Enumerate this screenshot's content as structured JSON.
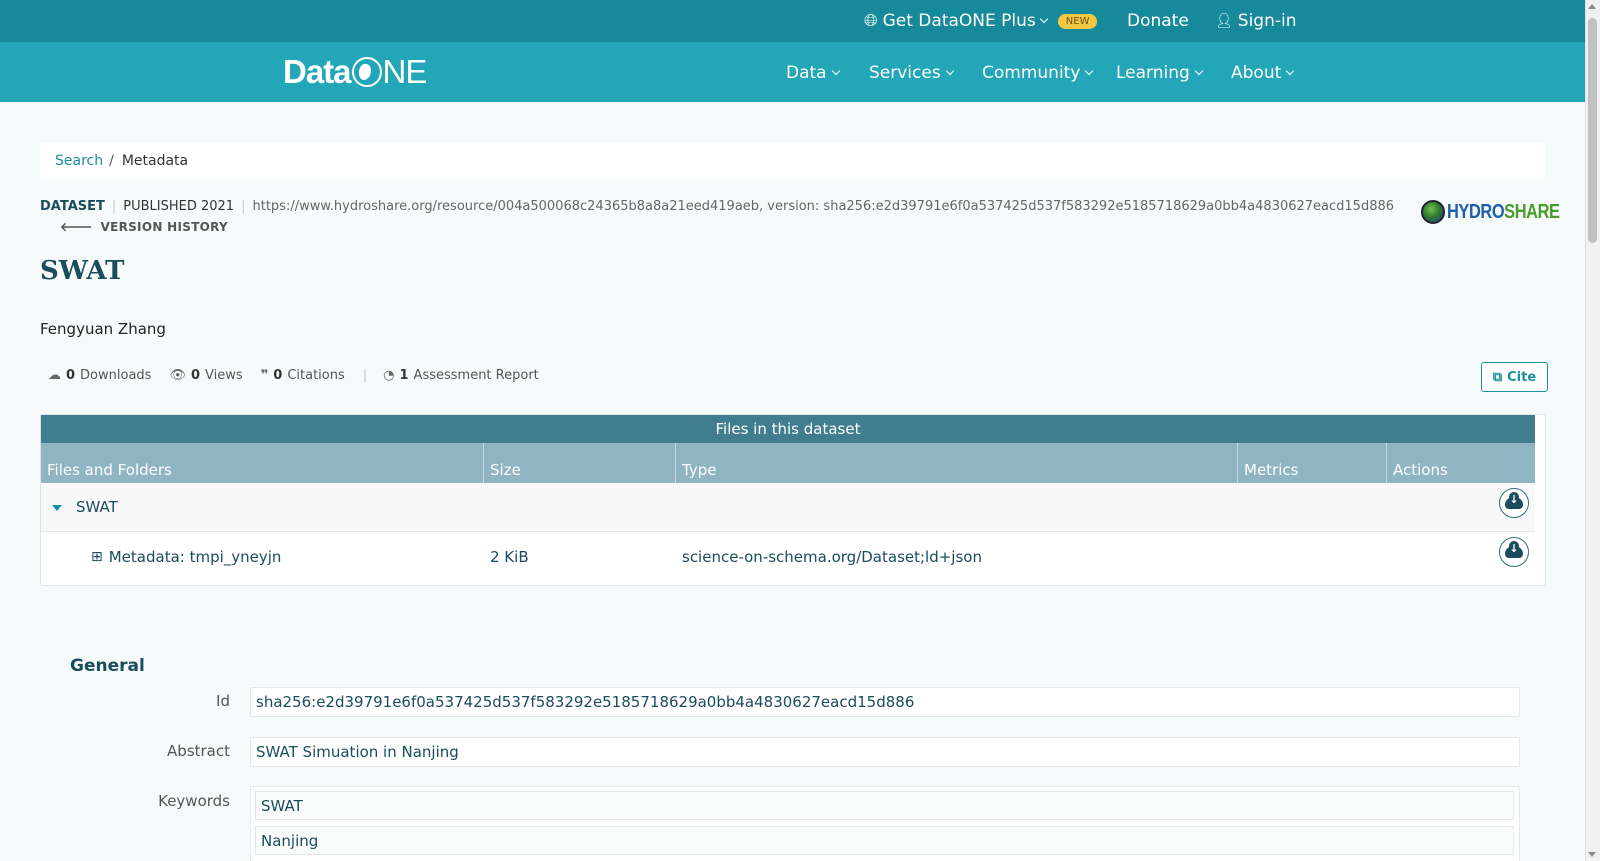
{
  "topbar": {
    "plus_label": "Get DataONE Plus",
    "new_badge": "NEW",
    "donate_label": "Donate",
    "signin_label": "Sign-in"
  },
  "nav": {
    "logo_data": "Data",
    "logo_ne": "NE",
    "items": [
      {
        "label": "Data"
      },
      {
        "label": "Services"
      },
      {
        "label": "Community"
      },
      {
        "label": "Learning"
      },
      {
        "label": "About"
      }
    ]
  },
  "breadcrumb": {
    "search": "Search",
    "separator": "/",
    "current": "Metadata"
  },
  "dataset": {
    "type_label": "DATASET",
    "published": "PUBLISHED 2021",
    "identifier": "https://www.hydroshare.org/resource/004a500068c24365b8a8a21eed419aeb, version: sha256:e2d39791e6f0a537425d537f583292e5185718629a0bb4a4830627eacd15d886",
    "version_history": "VERSION HISTORY",
    "repository_logo": {
      "hydro": "HYDRO",
      "share": "SHARE"
    },
    "title": "SWAT",
    "author": "Fengyuan Zhang"
  },
  "stats": {
    "downloads_count": "0",
    "downloads_label": "Downloads",
    "views_count": "0",
    "views_label": "Views",
    "citations_count": "0",
    "citations_label": "Citations",
    "assessment_count": "1",
    "assessment_label": "Assessment Report"
  },
  "cite_label": "Cite",
  "files": {
    "title": "Files in this dataset",
    "columns": [
      "Files and Folders",
      "Size",
      "Type",
      "Metrics",
      "Actions"
    ],
    "folder": "SWAT",
    "rows": [
      {
        "name": "Metadata: tmpi_yneyjn",
        "size": "2 KiB",
        "type": "science-on-schema.org/Dataset;ld+json"
      }
    ]
  },
  "general": {
    "heading": "General",
    "id_label": "Id",
    "id_value": "sha256:e2d39791e6f0a537425d537f583292e5185718629a0bb4a4830627eacd15d886",
    "abstract_label": "Abstract",
    "abstract_value": "SWAT Simuation in Nanjing",
    "keywords_label": "Keywords",
    "keywords": [
      "SWAT",
      "Nanjing"
    ]
  },
  "colors": {
    "topbar": "#16899b",
    "navbar": "#22a6b8",
    "accent": "#1a8fa0",
    "title": "#1a4d5c",
    "table_title": "#3f7d8f",
    "table_header": "#8fb4c2",
    "new_badge": "#f5c842"
  }
}
